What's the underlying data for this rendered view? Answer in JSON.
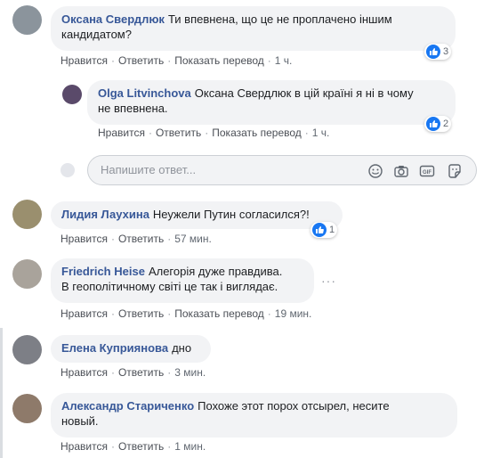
{
  "comments": [
    {
      "author": "Оксана Свердлюк",
      "text_line1": "Ти впевнена, що це не проплачено іншим",
      "text_line2": "кандидатом?",
      "reactions": "3",
      "like": "Нравится",
      "reply": "Ответить",
      "translate": "Показать перевод",
      "time": "1 ч."
    },
    {
      "author": "Olga Litvinchova",
      "text_line1": "Оксана Свердлюк в цій країні я ні в чому",
      "text_line2": "не впевнена.",
      "reactions": "2",
      "like": "Нравится",
      "reply": "Ответить",
      "translate": "Показать перевод",
      "time": "1 ч."
    },
    {
      "author": "Лидия Лаухина",
      "text_line1": "Неужели Путин согласился?!",
      "reactions": "1",
      "like": "Нравится",
      "reply": "Ответить",
      "time": "57 мин."
    },
    {
      "author": "Friedrich Heise",
      "text_line1": "Алегорія дуже правдива.",
      "text_line2": "В геополітичному світі це так і виглядає.",
      "like": "Нравится",
      "reply": "Ответить",
      "translate": "Показать перевод",
      "time": "19 мин."
    },
    {
      "author": "Елена Куприянова",
      "text_line1": "дно",
      "like": "Нравится",
      "reply": "Ответить",
      "time": "3 мин."
    },
    {
      "author": "Александр Стариченко",
      "text_line1": "Похоже этот порох отсырел, несите",
      "text_line2": "новый.",
      "like": "Нравится",
      "reply": "Ответить",
      "time": "1 мин."
    }
  ],
  "reply_box": {
    "placeholder": "Напишите ответ..."
  },
  "icons": [
    "emoji-icon",
    "camera-icon",
    "gif-icon",
    "sticker-icon",
    "like-icon",
    "more-options-icon"
  ],
  "colors": {
    "author": "#385898",
    "like_blue": "#1877f2",
    "bubble": "#f2f3f5"
  }
}
